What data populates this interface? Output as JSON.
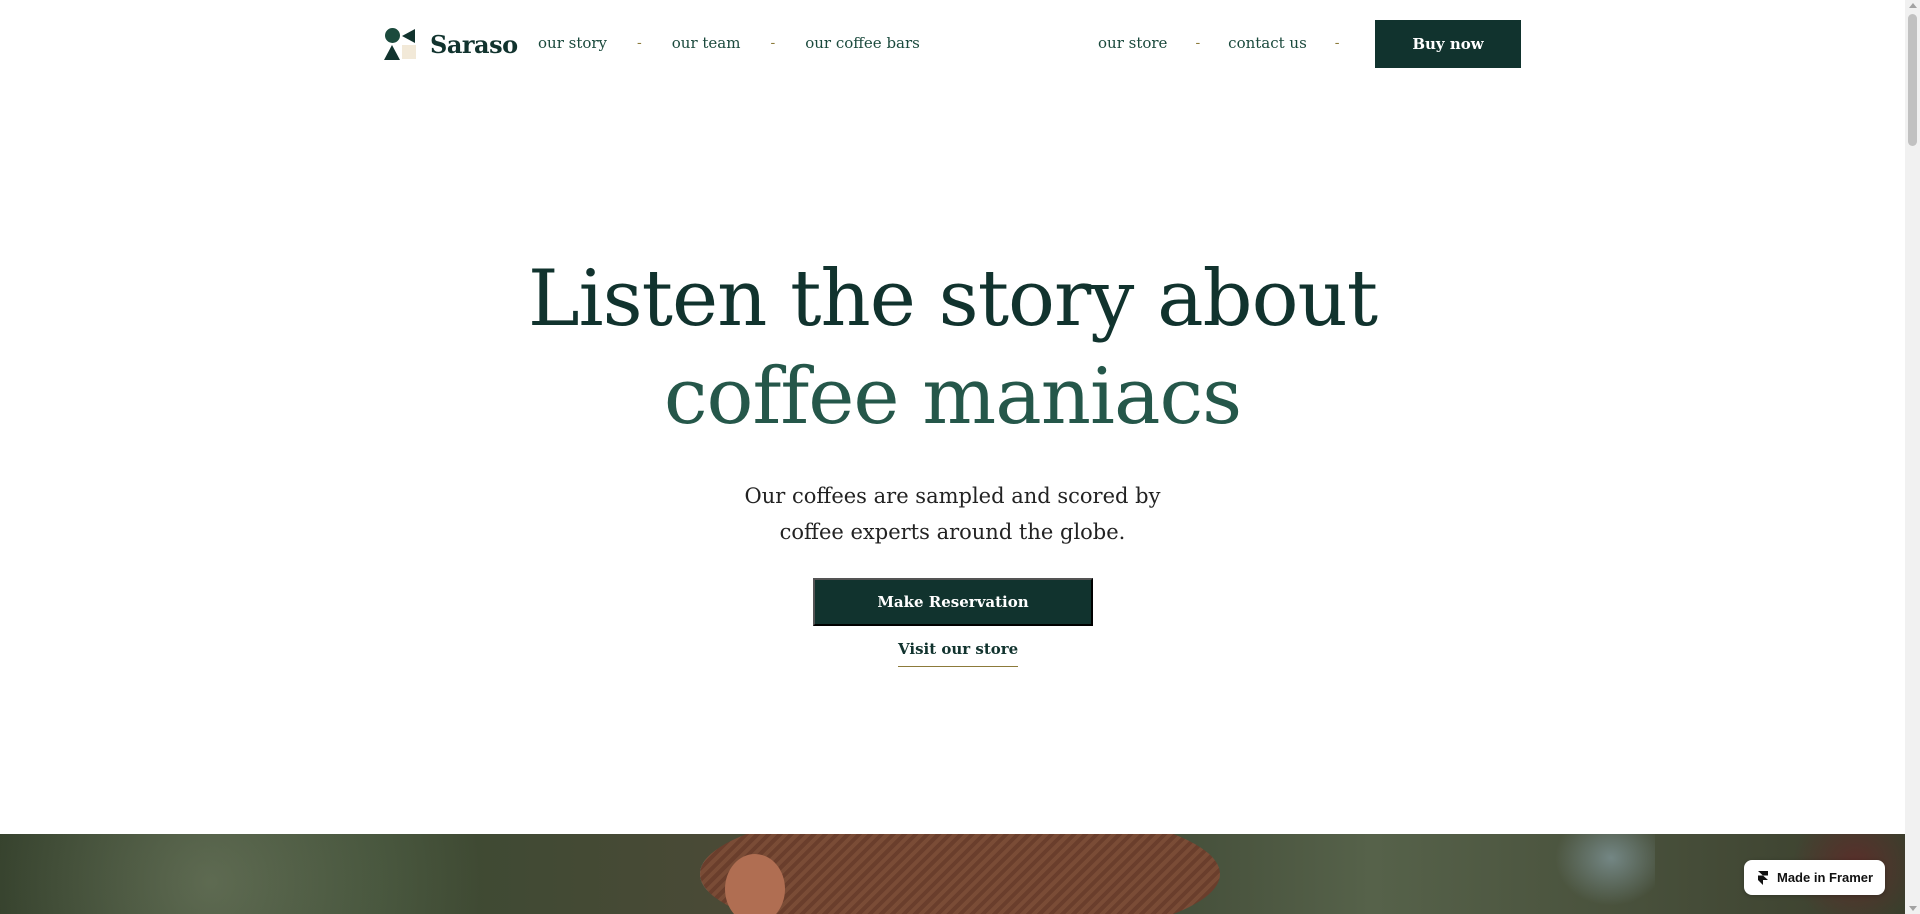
{
  "brand": {
    "name": "Saraso",
    "logo_icon": "saraso-logo-icon"
  },
  "nav": {
    "left": [
      {
        "label": "our story"
      },
      {
        "label": "our team"
      },
      {
        "label": "our coffee bars"
      }
    ],
    "right": [
      {
        "label": "our store"
      },
      {
        "label": "contact us"
      }
    ],
    "separator": "-",
    "cta_label": "Buy now"
  },
  "hero": {
    "title_line1": "Listen the story about",
    "title_line2": "coffee maniacs",
    "subtitle_line1": "Our coffees are sampled and scored by",
    "subtitle_line2": "coffee experts around the globe.",
    "primary_button": "Make Reservation",
    "secondary_link": "Visit our store"
  },
  "badge": {
    "label": "Made in Framer",
    "icon": "framer-icon"
  },
  "colors": {
    "primary": "#11332e",
    "accent_green": "#25574a",
    "separator": "#8c7a3a",
    "background": "#ffffff"
  }
}
